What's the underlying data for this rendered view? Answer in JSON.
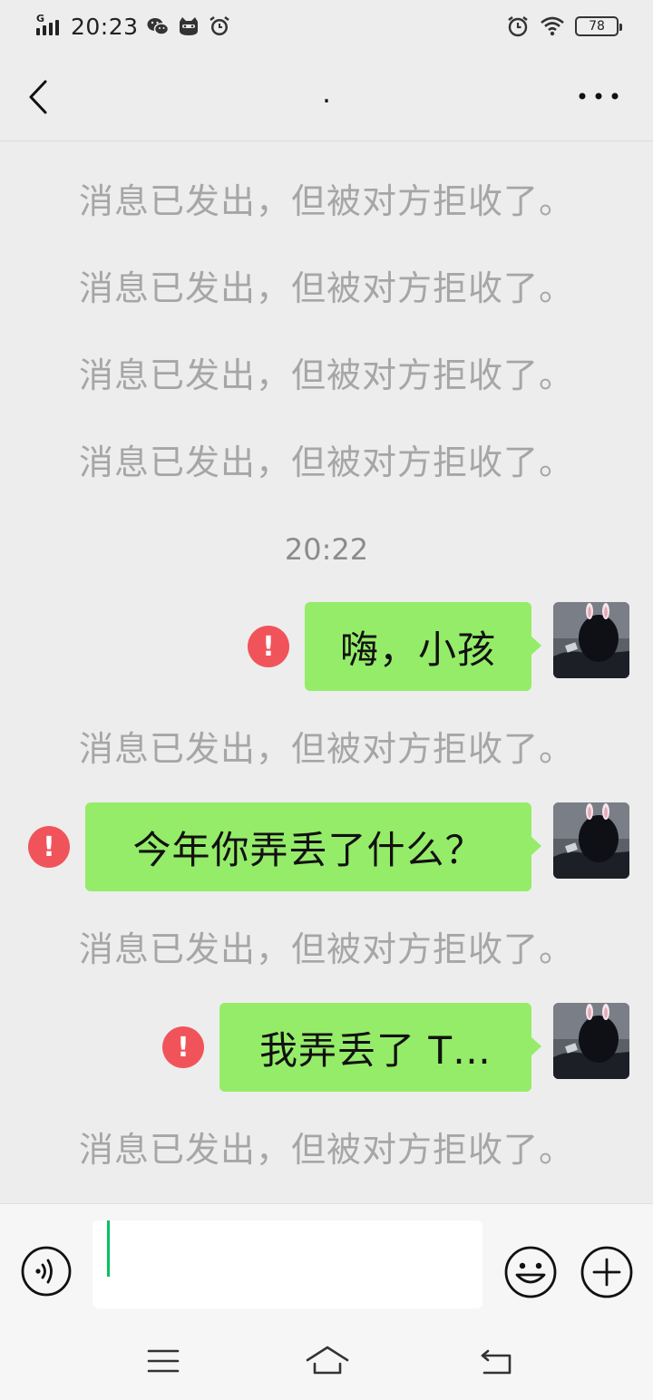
{
  "status_bar": {
    "network": "G",
    "time": "20:23",
    "battery": "78",
    "left_icons": [
      "signal-icon",
      "wechat-icon",
      "cat-face-icon",
      "alarm-icon"
    ],
    "right_icons": [
      "alarm-icon",
      "wifi-icon",
      "battery-icon"
    ]
  },
  "header": {
    "title": ".",
    "back_icon": "chevron-left-icon",
    "more_icon": "more-dots-icon"
  },
  "messages": {
    "system_rejected": "消息已发出，但被对方拒收了。",
    "timestamp": "20:22",
    "sent": [
      {
        "text": "嗨，小孩",
        "status": "failed"
      },
      {
        "text": "今年你弄丢了什么？",
        "status": "failed"
      },
      {
        "text": "我弄丢了 T…",
        "status": "failed"
      }
    ],
    "fail_mark": "!"
  },
  "input_bar": {
    "value": "",
    "icons": [
      "voice-icon",
      "emoji-icon",
      "plus-icon"
    ]
  },
  "nav_bar": {
    "icons": [
      "menu-icon",
      "home-icon",
      "back-icon"
    ]
  },
  "colors": {
    "background": "#ededed",
    "bubble": "#95ec69",
    "fail": "#f0545a",
    "system_text": "#a6a6a6",
    "caret": "#07c160"
  }
}
